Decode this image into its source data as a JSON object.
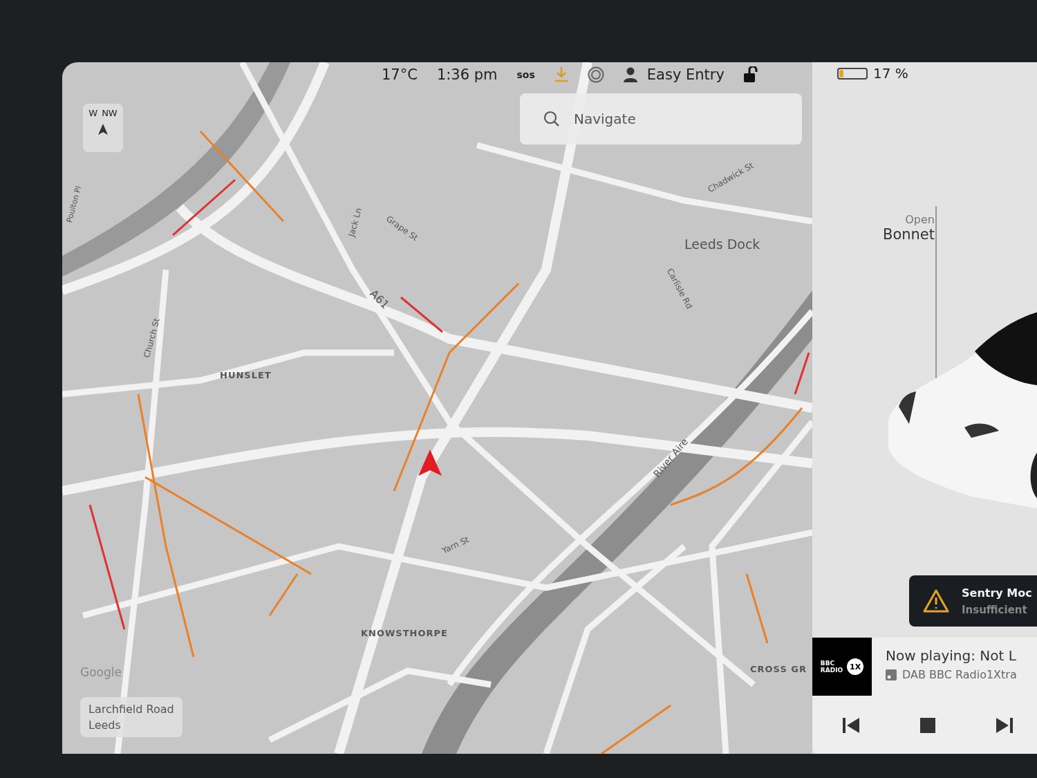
{
  "status_bar": {
    "temperature": "17°C",
    "time": "1:36 pm",
    "sos": "sos",
    "profile": "Easy Entry",
    "battery": {
      "level": 0.17,
      "reading": "17 %"
    }
  },
  "search": {
    "placeholder": "Navigate"
  },
  "compass": [
    "W",
    "NW"
  ],
  "map_labels": [
    "HUNSLET",
    "Leeds Dock",
    "A61",
    "Grape St",
    "Jack Ln",
    "Chadwick St",
    "Carlisle Rd",
    "Church St",
    "Poulton Pl",
    "River Aire",
    "Yarn St",
    "KNOWSTHORPE",
    "CROSS GR"
  ],
  "attribution": "Google",
  "location_card": [
    "Larchfield Road",
    "Leeds"
  ],
  "car": {
    "action": "Open",
    "part": "Bonnet"
  },
  "alert": {
    "title": "Sentry Moc",
    "message": "Insufficient"
  },
  "media": {
    "logo": [
      "BBC",
      "RADIO"
    ],
    "badge": "1X",
    "title": "Now playing: Not L",
    "station": "DAB BBC Radio1Xtra"
  }
}
